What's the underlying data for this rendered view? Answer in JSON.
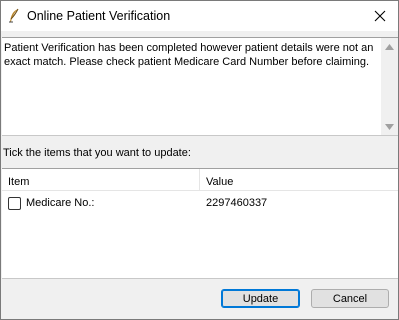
{
  "window": {
    "title": "Online Patient Verification",
    "app_icon": "feather-quill-icon",
    "close_icon": "close-icon"
  },
  "message": {
    "text": "Patient Verification has been completed however patient details were not an exact match. Please check patient Medicare Card Number before claiming."
  },
  "instruction": "Tick the items that you want to update:",
  "table": {
    "columns": [
      "Item",
      "Value"
    ],
    "rows": [
      {
        "item": "Medicare No.:",
        "value": "2297460337",
        "checked": false
      }
    ]
  },
  "buttons": {
    "update": "Update",
    "cancel": "Cancel"
  },
  "colors": {
    "default_button_border": "#0078d7",
    "window_background": "#f0f0f0"
  }
}
